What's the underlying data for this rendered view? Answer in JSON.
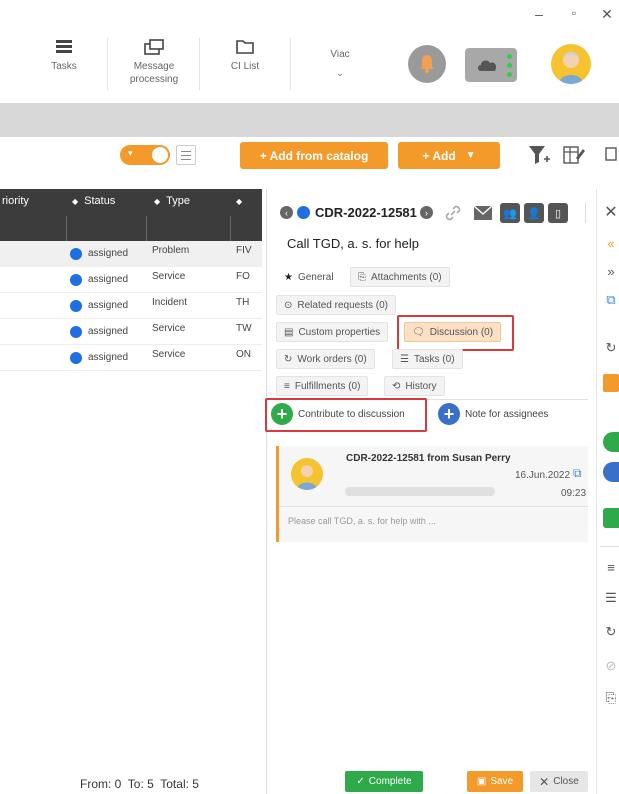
{
  "window": {
    "minimize": "–",
    "maximize": "▫",
    "close": "✕"
  },
  "toolbar": {
    "items": [
      {
        "label": "Tasks",
        "icon": "tasks-icon"
      },
      {
        "label": "Message processing",
        "icon": "message-icon"
      },
      {
        "label": "CI List",
        "icon": "folder-icon"
      },
      {
        "label": "Viac",
        "icon": "chevron-down-icon"
      }
    ]
  },
  "actions": {
    "add_from_catalog": "+ Add from catalog",
    "add": "+ Add"
  },
  "table": {
    "headers": [
      "riority",
      "Status",
      "Type",
      ""
    ],
    "rows": [
      {
        "status": "assigned",
        "type": "Problem",
        "extra": "FIV"
      },
      {
        "status": "assigned",
        "type": "Service",
        "extra": "FO"
      },
      {
        "status": "assigned",
        "type": "Incident",
        "extra": "TH"
      },
      {
        "status": "assigned",
        "type": "Service",
        "extra": "TW"
      },
      {
        "status": "assigned",
        "type": "Service",
        "extra": "ON"
      }
    ],
    "footer": "From: 0  To: 5  Total: 5"
  },
  "detail": {
    "ticket_id": "CDR-2022-12581",
    "title": "Call TGD, a. s. for help",
    "tabs": {
      "general": "General",
      "attachments": "Attachments (0)",
      "related": "Related requests (0)",
      "custom": "Custom properties",
      "discussion": "Discussion (0)",
      "work_orders": "Work orders (0)",
      "tasks": "Tasks (0)",
      "fulfillments": "Fulfillments (0)",
      "history": "History"
    },
    "contribute": "Contribute to discussion",
    "note": "Note for assignees",
    "message": {
      "header": "CDR-2022-12581 from Susan Perry",
      "date": "16.Jun.2022",
      "time": "09:23",
      "body": "Please call TGD, a. s. for help with ..."
    },
    "complete": "Complete",
    "save": "Save",
    "close": "Close"
  },
  "colors": {
    "accent": "#f39a2a",
    "primary": "#1e6fe0",
    "green": "#2eaa4a",
    "highlight": "#d63a3a"
  }
}
